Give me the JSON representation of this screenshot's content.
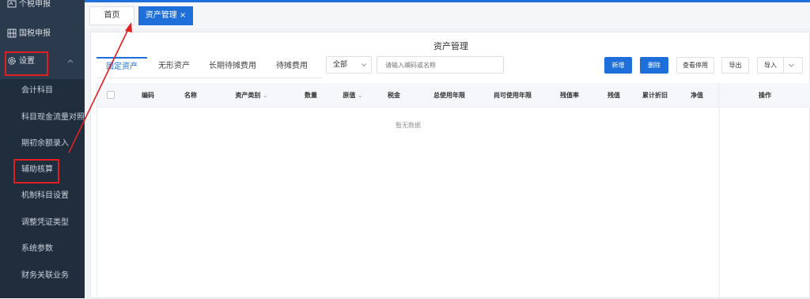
{
  "sidebar": {
    "items": [
      {
        "label": "个税申报",
        "icon": "tax-person-icon"
      },
      {
        "label": "国税申报",
        "icon": "tax-national-icon"
      },
      {
        "label": "设置",
        "icon": "gear-icon"
      }
    ],
    "sub_items": [
      {
        "label": "会计科目"
      },
      {
        "label": "科目现金流量对照"
      },
      {
        "label": "期初余额录入"
      },
      {
        "label": "辅助核算"
      },
      {
        "label": "机制科目设置"
      },
      {
        "label": "调整凭证类型"
      },
      {
        "label": "系统参数"
      },
      {
        "label": "财务关联业务"
      }
    ]
  },
  "tabs": [
    {
      "label": "首页"
    },
    {
      "label": "资产管理"
    }
  ],
  "page": {
    "title": "资产管理",
    "subtabs": [
      "固定资产",
      "无形资产",
      "长期待摊费用",
      "待摊费用"
    ],
    "filter": {
      "selected": "全部"
    },
    "search": {
      "placeholder": "请输入编码或名称"
    },
    "buttons": {
      "add": "新增",
      "delete": "删除",
      "view_disabled": "查看停用",
      "export": "导出",
      "import": "导入"
    },
    "table": {
      "columns": [
        "编码",
        "名称",
        "资产类别",
        "数量",
        "原值",
        "税金",
        "总使用年限",
        "尚可使用年限",
        "残值率",
        "残值",
        "累计折旧",
        "净值",
        "操作"
      ],
      "empty_text": "暂无数据"
    }
  },
  "colors": {
    "primary": "#1e6fd9",
    "sidebar_bg": "#2b3a4c",
    "annotation_red": "#e02020"
  }
}
